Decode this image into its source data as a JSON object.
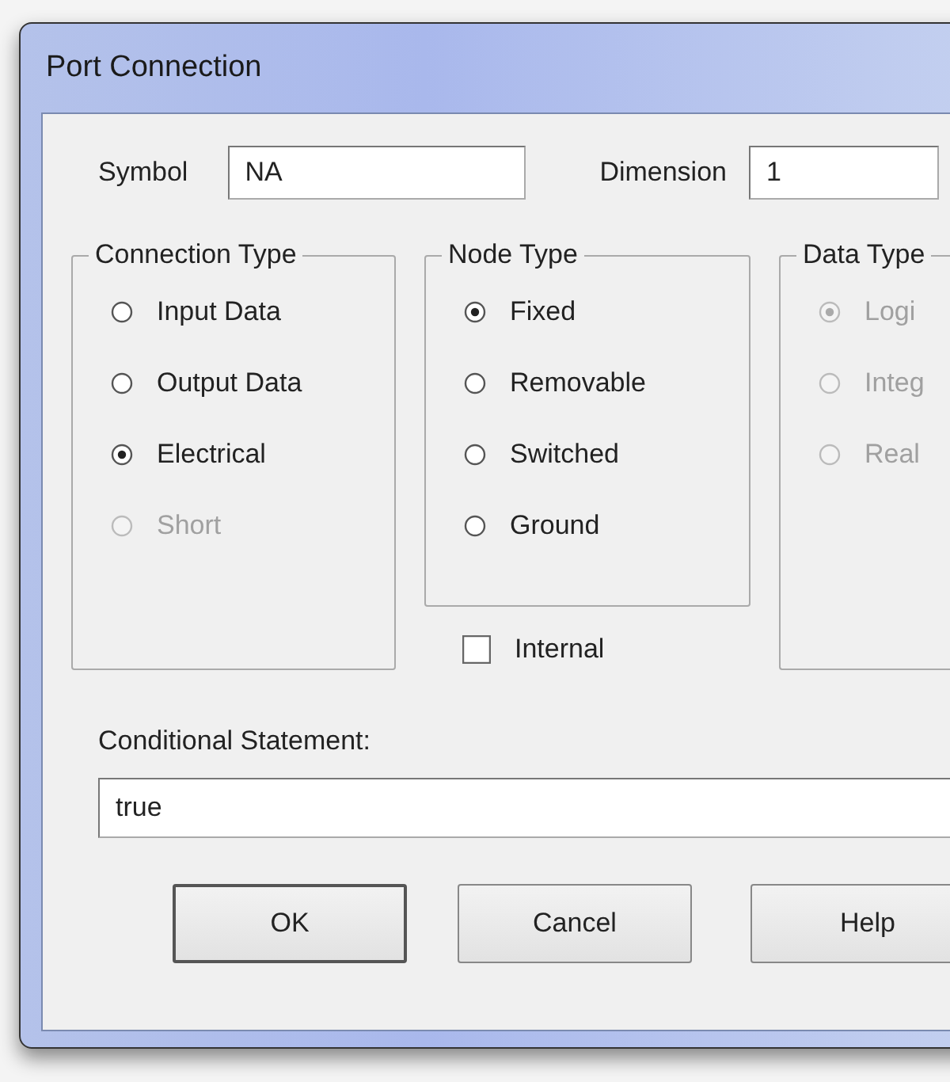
{
  "window": {
    "title": "Port Connection"
  },
  "symbol": {
    "label": "Symbol",
    "value": "NA"
  },
  "dimension": {
    "label": "Dimension",
    "value": "1"
  },
  "groups": [
    {
      "title": "Connection Type",
      "options": [
        {
          "label": "Input Data",
          "selected": false,
          "disabled": false
        },
        {
          "label": "Output Data",
          "selected": false,
          "disabled": false
        },
        {
          "label": "Electrical",
          "selected": true,
          "disabled": false
        },
        {
          "label": "Short",
          "selected": false,
          "disabled": true
        }
      ]
    },
    {
      "title": "Node Type",
      "options": [
        {
          "label": "Fixed",
          "selected": true,
          "disabled": false
        },
        {
          "label": "Removable",
          "selected": false,
          "disabled": false
        },
        {
          "label": "Switched",
          "selected": false,
          "disabled": false
        },
        {
          "label": "Ground",
          "selected": false,
          "disabled": false
        }
      ]
    },
    {
      "title": "Data Type",
      "options": [
        {
          "label": "Logi",
          "selected": true,
          "disabled": true
        },
        {
          "label": "Integ",
          "selected": false,
          "disabled": true
        },
        {
          "label": "Real",
          "selected": false,
          "disabled": true
        }
      ]
    }
  ],
  "internal": {
    "label": "Internal",
    "checked": false
  },
  "conditional": {
    "label": "Conditional Statement:",
    "value": "true"
  },
  "buttons": [
    {
      "label": "OK",
      "default": true
    },
    {
      "label": "Cancel",
      "default": false
    },
    {
      "label": "Help",
      "default": false
    }
  ]
}
